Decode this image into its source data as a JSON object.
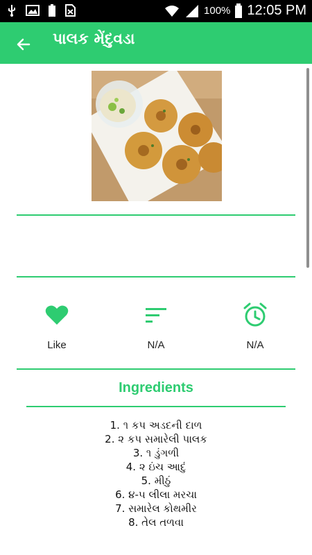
{
  "status": {
    "battery": "100%",
    "time": "12:05 PM"
  },
  "appbar": {
    "title": "પાલક મેંદુવડા"
  },
  "actions": {
    "like_label": "Like",
    "sort_label": "N/A",
    "alarm_label": "N/A"
  },
  "ingredients": {
    "title": "Ingredients",
    "items": [
      "1. ૧ કપ અડદની દાળ",
      "2. ૨ કપ સમારેલી પાલક",
      "3. ૧ ડુંગળી",
      "4. ૨ ઇંચ આદું",
      "5. મીઠું",
      "6. ૪-૫ લીલા મરચા",
      "7. સમારેલ કોથમીર",
      "8. તેલ તળવા"
    ]
  },
  "colors": {
    "accent": "#2ecc71",
    "statusbar": "#000000"
  },
  "icons": [
    "usb-icon",
    "image-icon",
    "battery-small-icon",
    "no-sim-icon",
    "wifi-icon",
    "signal-icon",
    "battery-icon",
    "back-arrow-icon",
    "heart-icon",
    "sort-icon",
    "alarm-icon"
  ]
}
